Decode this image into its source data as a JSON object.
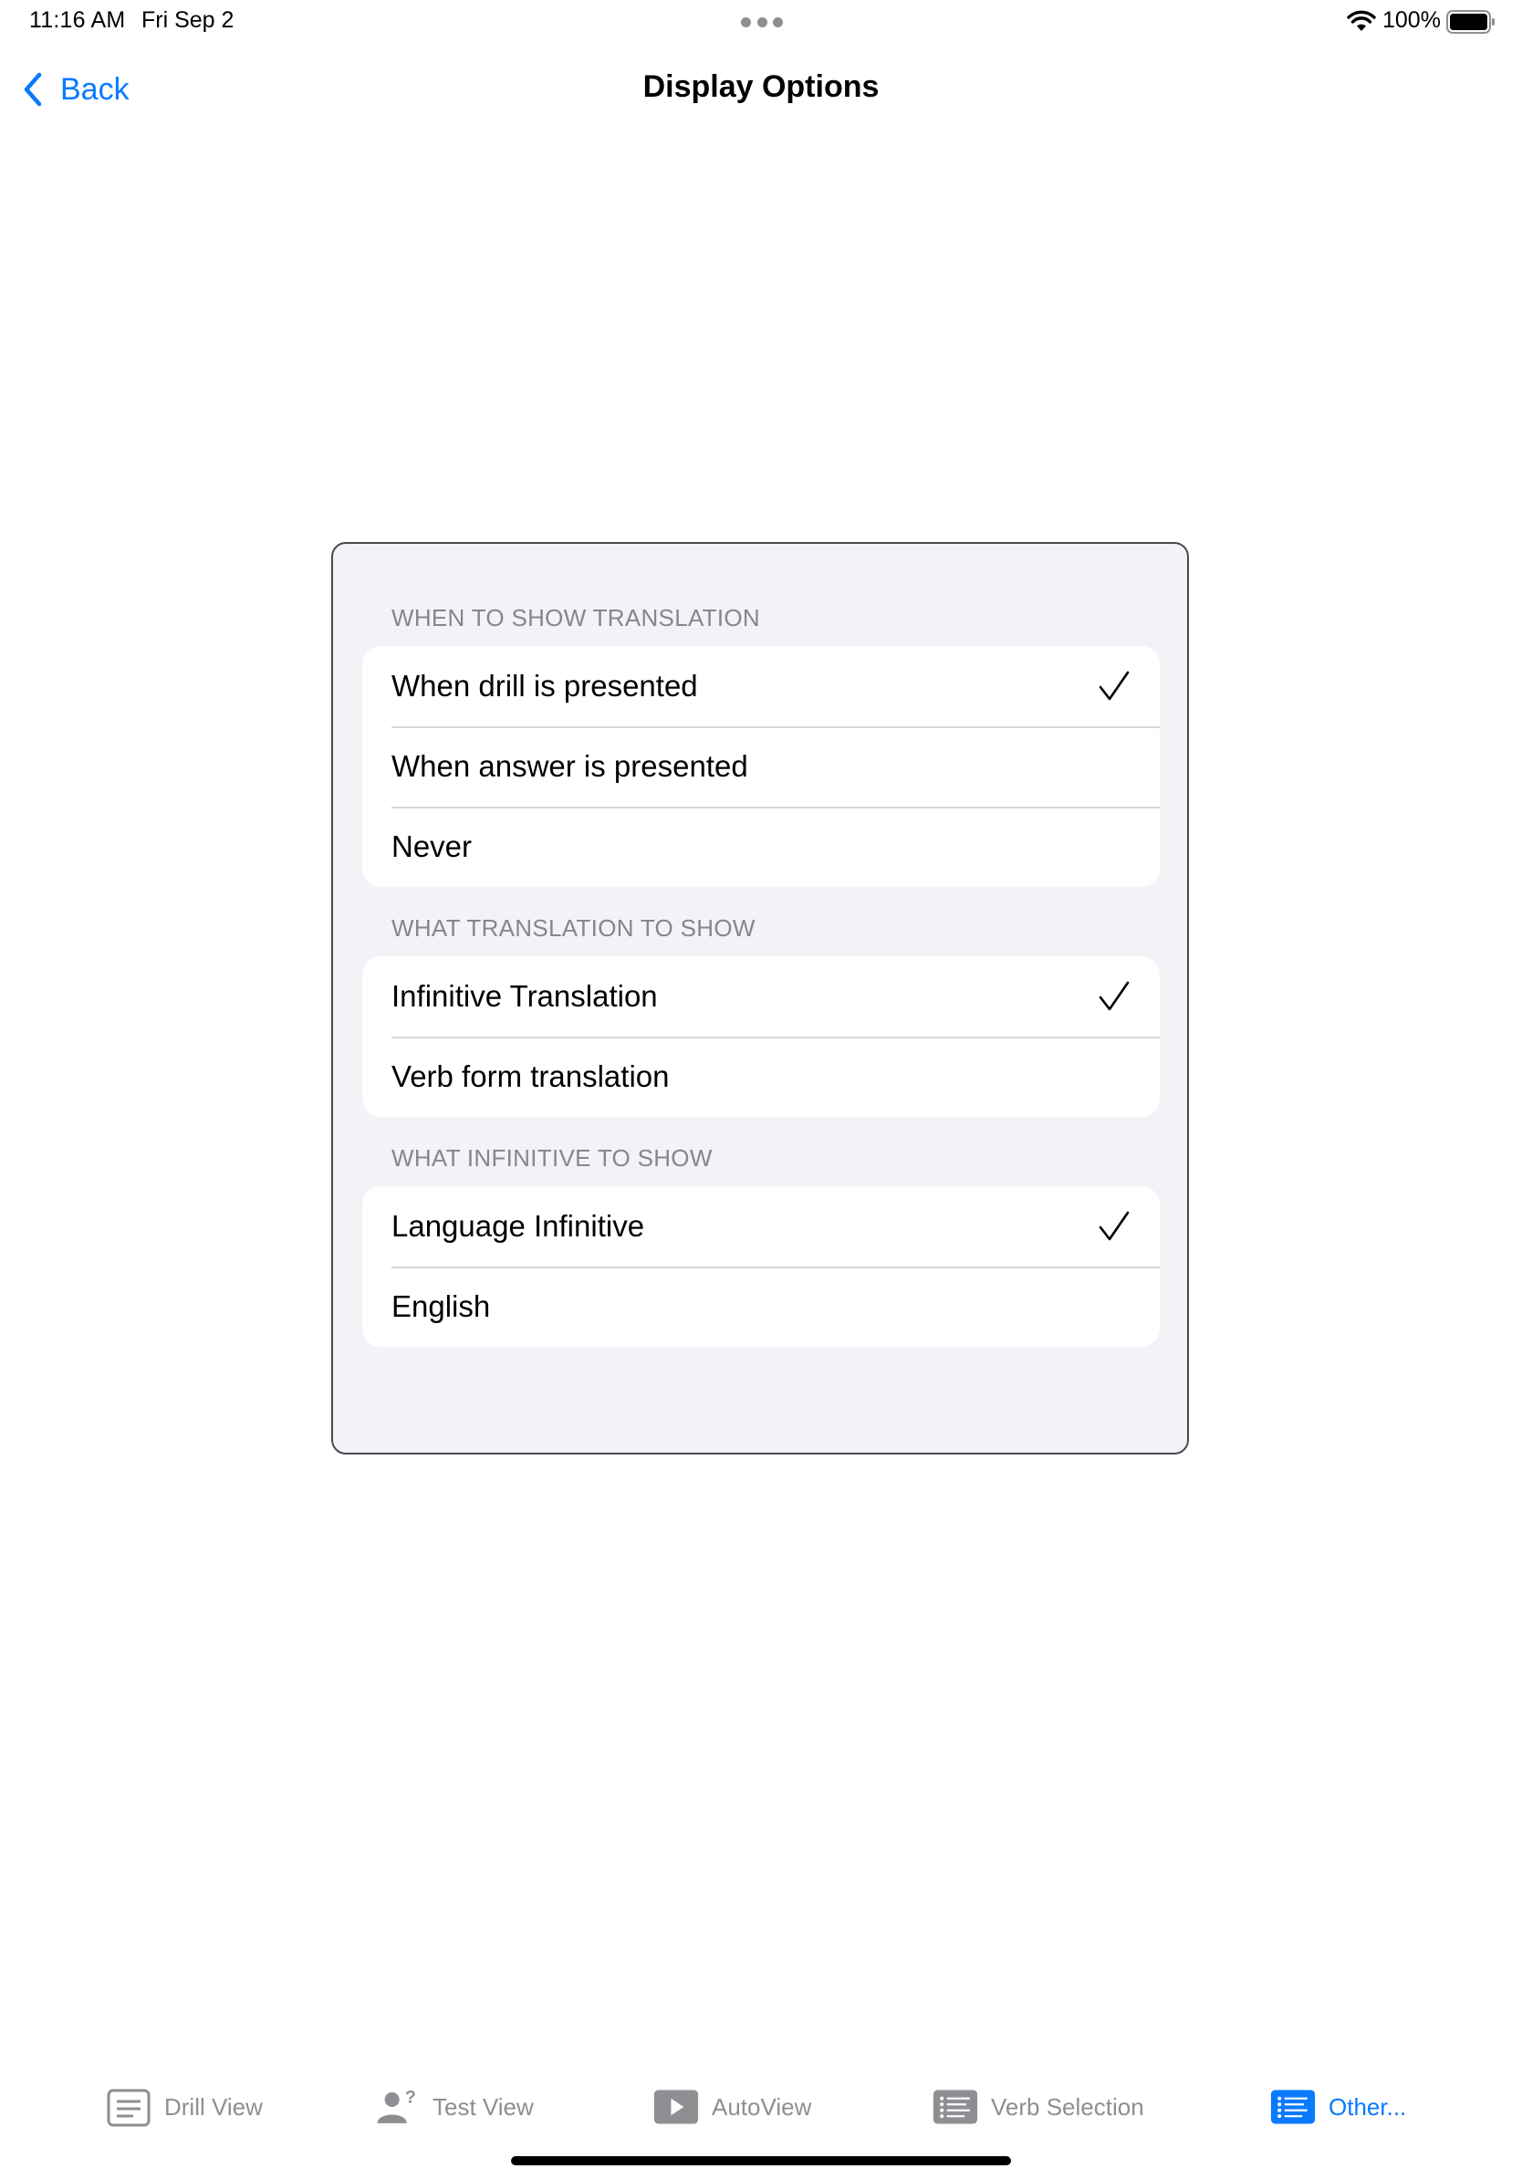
{
  "status_bar": {
    "time": "11:16 AM",
    "date": "Fri Sep 2",
    "battery": "100%"
  },
  "nav": {
    "back_label": "Back",
    "title": "Display Options"
  },
  "sections": [
    {
      "header": "WHEN TO SHOW TRANSLATION",
      "rows": [
        {
          "label": "When drill is presented",
          "checked": true
        },
        {
          "label": "When answer is presented",
          "checked": false
        },
        {
          "label": "Never",
          "checked": false
        }
      ]
    },
    {
      "header": "WHAT TRANSLATION TO SHOW",
      "rows": [
        {
          "label": "Infinitive Translation",
          "checked": true
        },
        {
          "label": "Verb form translation",
          "checked": false
        }
      ]
    },
    {
      "header": "WHAT INFINITIVE TO SHOW",
      "rows": [
        {
          "label": "Language Infinitive",
          "checked": true
        },
        {
          "label": "English",
          "checked": false
        }
      ]
    }
  ],
  "tab_bar": {
    "tabs": [
      {
        "label": "Drill View",
        "icon": "drill-view-icon",
        "active": false
      },
      {
        "label": "Test View",
        "icon": "test-view-icon",
        "active": false
      },
      {
        "label": "AutoView",
        "icon": "play-icon",
        "active": false
      },
      {
        "label": "Verb Selection",
        "icon": "list-icon",
        "active": false
      },
      {
        "label": "Other...",
        "icon": "list-icon",
        "active": true
      }
    ]
  },
  "colors": {
    "accent": "#0a7aff",
    "inactive": "#8e8e93",
    "grouped_background": "#f2f2f7"
  }
}
